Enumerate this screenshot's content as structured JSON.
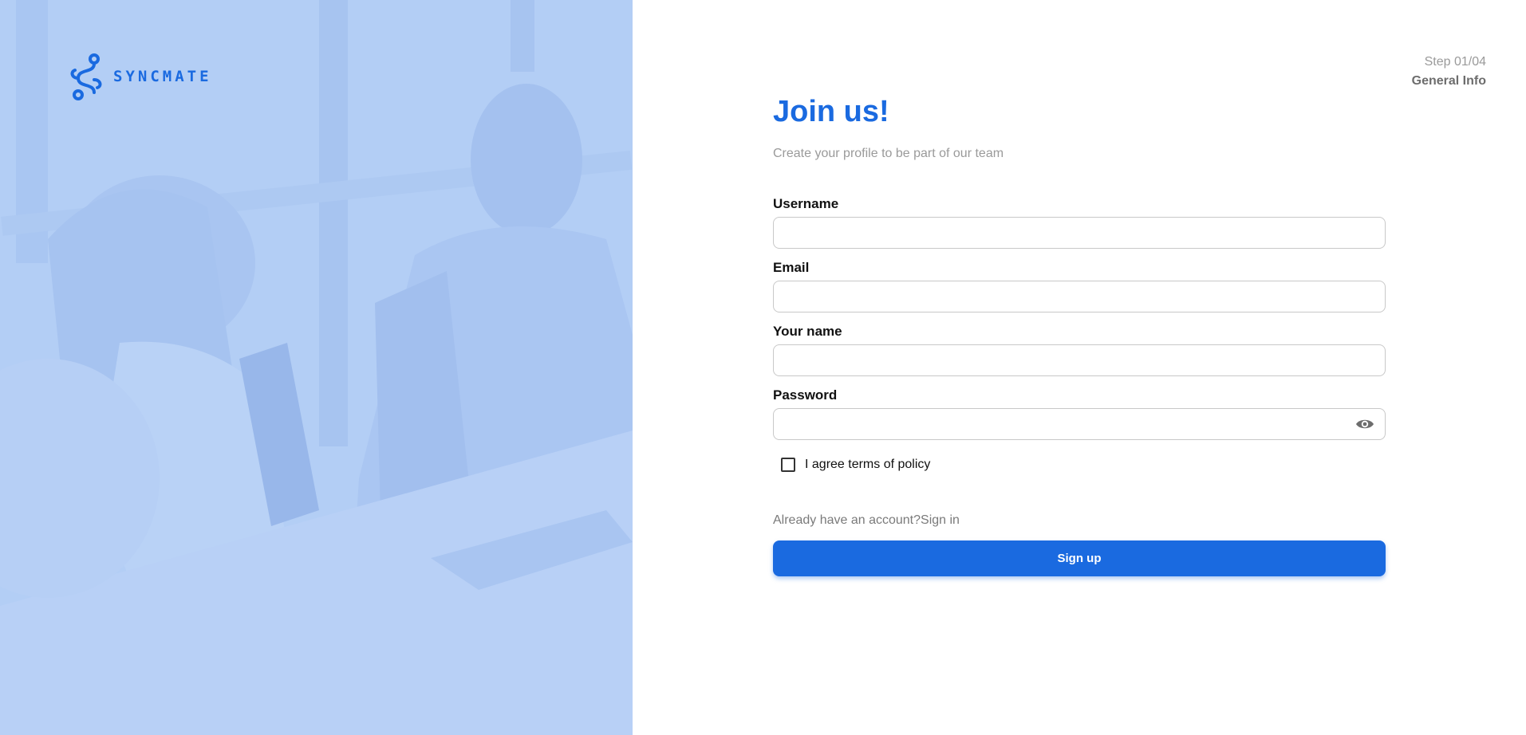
{
  "brand": {
    "name": "SYNCMATE",
    "logo_icon": "syncmate-logo-icon",
    "accent_color": "#1a6ae0"
  },
  "hero": {
    "background_color": "#b3cef5",
    "image": "office-people-working-photo"
  },
  "progress": {
    "step_text": "Step 01/04",
    "step_name": "General Info"
  },
  "header": {
    "title": "Join us!",
    "subtitle": "Create your profile to be part of our team"
  },
  "form": {
    "username": {
      "label": "Username",
      "value": "",
      "placeholder": ""
    },
    "email": {
      "label": "Email",
      "value": "",
      "placeholder": ""
    },
    "name": {
      "label": "Your name",
      "value": "",
      "placeholder": ""
    },
    "password": {
      "label": "Password",
      "value": "",
      "placeholder": "",
      "toggle_icon": "eye-icon"
    },
    "agree": {
      "label": "I agree terms of policy",
      "checked": false
    }
  },
  "signin": {
    "prompt": "Already have an account?",
    "link": "Sign in"
  },
  "submit": {
    "label": "Sign up"
  }
}
